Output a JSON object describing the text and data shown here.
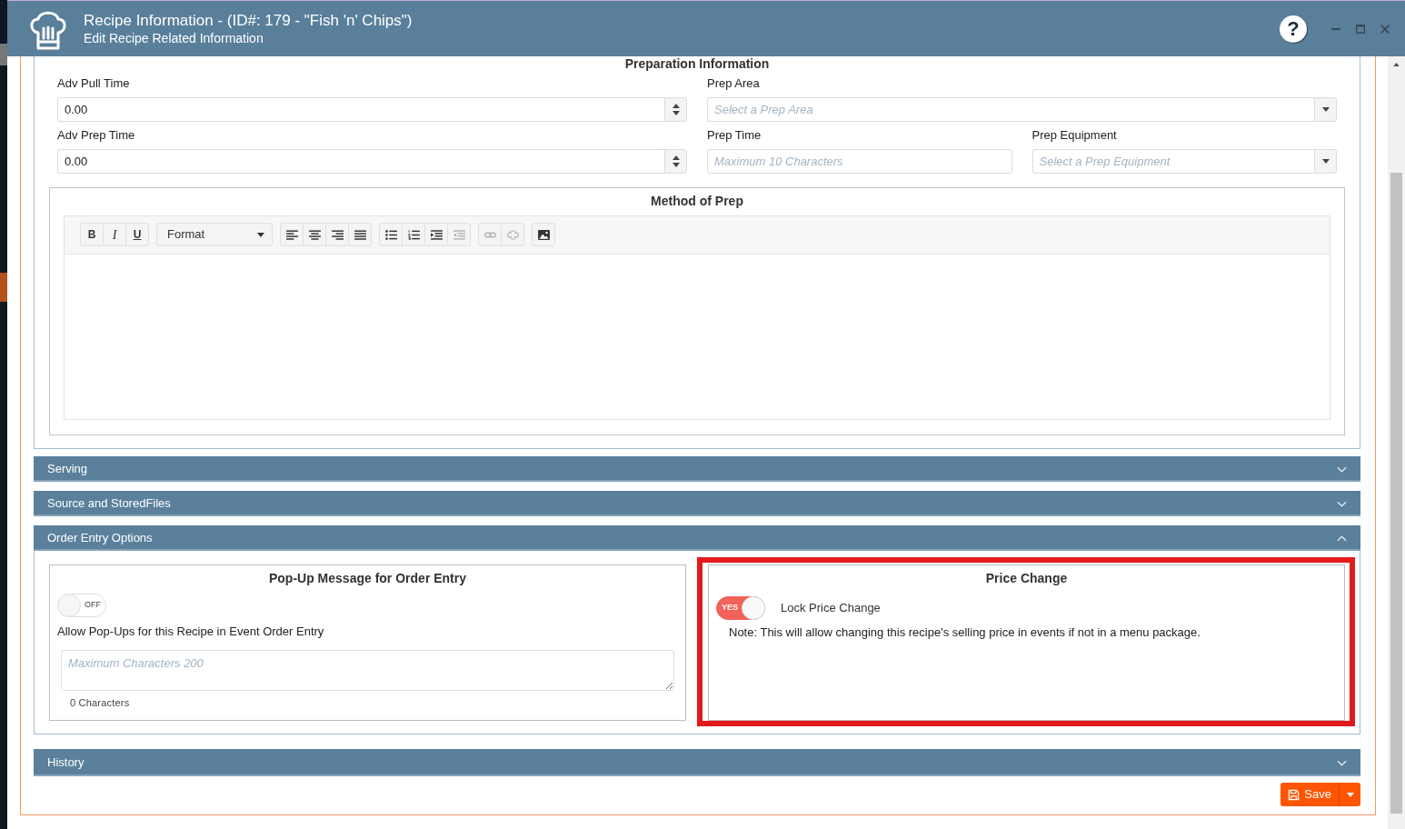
{
  "window": {
    "title": "Recipe Information - (ID#: 179 - \"Fish 'n' Chips\")",
    "subtitle": "Edit Recipe Related Information",
    "help": "?"
  },
  "preparation": {
    "heading": "Preparation Information",
    "rows": [
      {
        "fields": [
          {
            "kind": "number",
            "label": "Adv Pull Time",
            "value": "0.00"
          },
          {
            "kind": "select",
            "label": "Prep Area",
            "placeholder": "Select a Prep Area"
          }
        ]
      },
      {
        "fields": [
          {
            "kind": "number",
            "label": "Adv Prep Time",
            "value": "0.00"
          },
          {
            "kind": "text",
            "label": "Prep Time",
            "placeholder": "Maximum 10 Characters"
          },
          {
            "kind": "select",
            "label": "Prep Equipment",
            "placeholder": "Select a Prep Equipment"
          }
        ]
      }
    ]
  },
  "method": {
    "title": "Method of Prep",
    "toolbar": [
      {
        "buttons": [
          {
            "kind": "bold",
            "label": "B",
            "disabled": false
          },
          {
            "kind": "italic",
            "label": "I",
            "disabled": false
          },
          {
            "kind": "underline",
            "label": "U",
            "disabled": false
          }
        ]
      },
      {
        "buttons": [
          {
            "kind": "format",
            "label": "Format",
            "disabled": false
          }
        ]
      },
      {
        "buttons": [
          {
            "kind": "alignleft",
            "disabled": false
          },
          {
            "kind": "aligncenter",
            "disabled": false
          },
          {
            "kind": "alignright",
            "disabled": false
          },
          {
            "kind": "justify",
            "disabled": false
          }
        ]
      },
      {
        "buttons": [
          {
            "kind": "bulletlist",
            "disabled": false
          },
          {
            "kind": "numberlist",
            "disabled": false
          },
          {
            "kind": "indent",
            "disabled": false
          },
          {
            "kind": "outdent",
            "disabled": true
          }
        ]
      },
      {
        "buttons": [
          {
            "kind": "link",
            "disabled": true
          },
          {
            "kind": "unlink",
            "disabled": true
          }
        ]
      },
      {
        "buttons": [
          {
            "kind": "image",
            "disabled": false
          }
        ]
      }
    ]
  },
  "sections": [
    {
      "title": "Serving",
      "expanded": false
    },
    {
      "title": "Source and StoredFiles",
      "expanded": false
    },
    {
      "title": "Order Entry Options",
      "expanded": true,
      "body": {
        "popup": {
          "title": "Pop-Up Message for Order Entry",
          "toggle": {
            "on": false,
            "label": "OFF"
          },
          "description": "Allow Pop-Ups for this Recipe in Event Order Entry",
          "message": {
            "placeholder": "Maximum Characters 200"
          },
          "counter": "0 Characters"
        },
        "price_change": {
          "title": "Price Change",
          "highlighted": true,
          "toggle": {
            "on": true,
            "label": "YES"
          },
          "toggle_caption": "Lock Price Change",
          "note": "Note: This will allow changing this recipe's selling price in events if not in a menu package."
        }
      }
    },
    {
      "title": "History",
      "expanded": false
    }
  ],
  "save": {
    "label": "Save"
  }
}
